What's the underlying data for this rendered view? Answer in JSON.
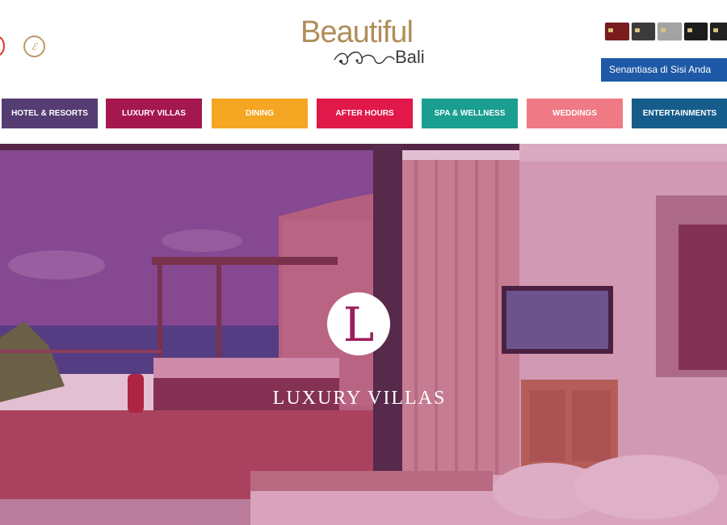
{
  "header": {
    "logo_main": "Beautiful",
    "logo_sub": "Bali",
    "social_icons": [
      "pinterest-icon",
      "circle-logo-icon"
    ],
    "card_colors": [
      "#7a1b1e",
      "#3b3b3b",
      "#a3a3a3",
      "#1c1c1c",
      "#222222"
    ],
    "tagline": "Senantiasa di Sisi Anda"
  },
  "nav": {
    "items": [
      {
        "label": "HOTEL & RESORTS",
        "color": "#553c72"
      },
      {
        "label": "LUXURY VILLAS",
        "color": "#a4184f"
      },
      {
        "label": "DINING",
        "color": "#f5a623"
      },
      {
        "label": "AFTER HOURS",
        "color": "#e1184a"
      },
      {
        "label": "SPA & WELLNESS",
        "color": "#1a9e90"
      },
      {
        "label": "WEDDINGS",
        "color": "#ef7a85"
      },
      {
        "label": "ENTERTAINMENTS",
        "color": "#155c8b"
      }
    ]
  },
  "hero": {
    "emblem_letter": "L",
    "title": "LUXURY VILLAS",
    "overlay_color": "#9b1964"
  }
}
